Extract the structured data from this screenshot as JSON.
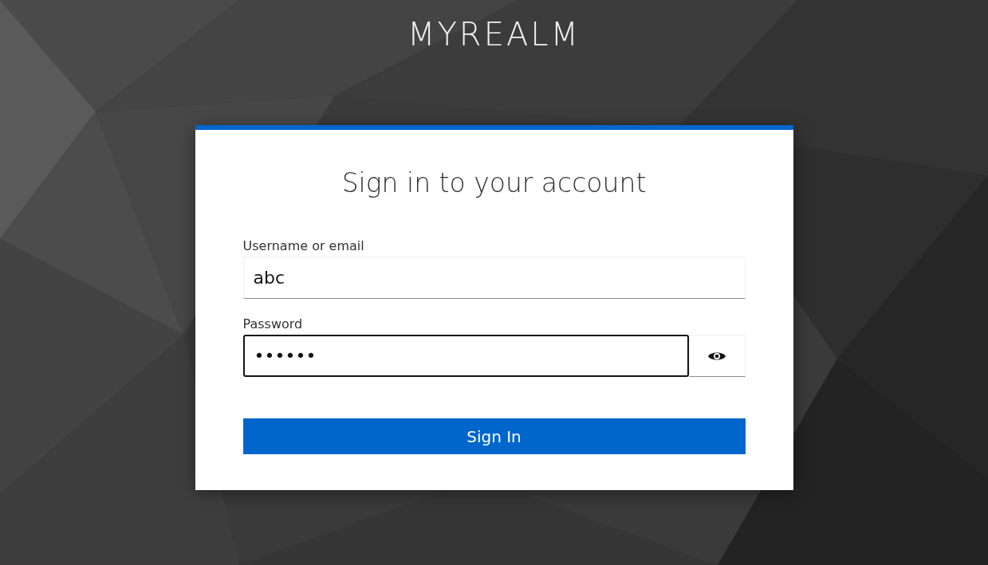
{
  "realm": {
    "title": "MYREALM"
  },
  "card": {
    "heading": "Sign in to your account",
    "fields": [
      {
        "kind": "text",
        "label": "Username or email",
        "value": "abc",
        "focused": false
      },
      {
        "kind": "password",
        "label": "Password",
        "value": "••••••",
        "focused": true
      }
    ],
    "submit": "Sign In"
  }
}
